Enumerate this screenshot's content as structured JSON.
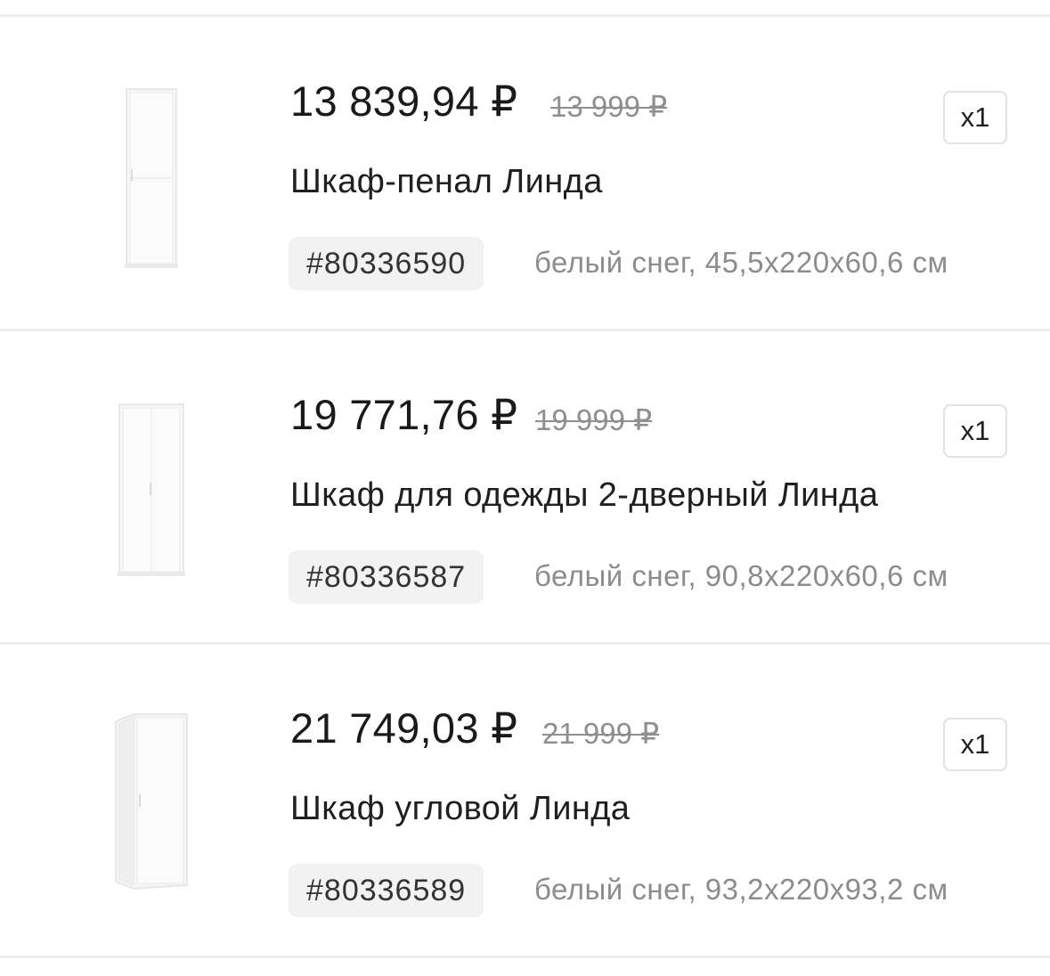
{
  "items": [
    {
      "price": "13 839,94 ₽",
      "old_price": "13 999 ₽",
      "name": "Шкаф-пенал Линда",
      "sku": "#80336590",
      "specs": "белый снег, 45,5x220x60,6 см",
      "quantity": "x1",
      "image": "single-door-tall-wardrobe"
    },
    {
      "price": "19 771,76 ₽",
      "old_price": "19 999 ₽",
      "name": "Шкаф для одежды 2-дверный Линда",
      "sku": "#80336587",
      "specs": "белый снег, 90,8x220x60,6 см",
      "quantity": "x1",
      "image": "two-door-wardrobe"
    },
    {
      "price": "21 749,03 ₽",
      "old_price": "21 999 ₽",
      "name": "Шкаф угловой Линда",
      "sku": "#80336589",
      "specs": "белый снег, 93,2x220x93,2 см",
      "quantity": "x1",
      "image": "corner-wardrobe"
    }
  ],
  "colors": {
    "divider": "#eeeeee",
    "price_text": "#1a1a1a",
    "old_price_text": "#8f8f8f",
    "specs_text": "#8c8c8c",
    "sku_background": "#f2f2f2",
    "qty_border": "#e2e2e2"
  }
}
